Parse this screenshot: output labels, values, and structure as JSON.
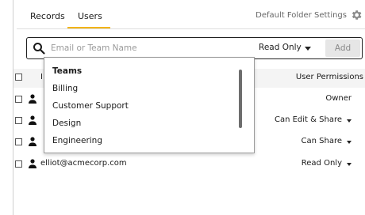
{
  "tabs": {
    "records": "Records",
    "users": "Users",
    "active_color": "#f2b418"
  },
  "header_right": {
    "folder_settings_label": "Default Folder Settings",
    "icon": "gear-icon"
  },
  "search": {
    "placeholder": "Email or Team Name",
    "value": "",
    "permission_value": "Read Only",
    "add_label": "Add"
  },
  "table": {
    "header_permissions": "User Permissions",
    "rows": [
      {
        "label": "",
        "permission": "Owner",
        "has_caret": false
      },
      {
        "label": "",
        "permission": "Can Edit & Share",
        "has_caret": true
      },
      {
        "label": "",
        "permission": "Can Share",
        "has_caret": true
      },
      {
        "label": "elliot@acmecorp.com",
        "permission": "Read Only",
        "has_caret": true
      }
    ]
  },
  "dropdown": {
    "items": [
      {
        "label": "Teams",
        "bold": true
      },
      {
        "label": "Billing",
        "bold": false
      },
      {
        "label": "Customer Support",
        "bold": false
      },
      {
        "label": "Design",
        "bold": false
      },
      {
        "label": "Engineering",
        "bold": false
      }
    ]
  }
}
